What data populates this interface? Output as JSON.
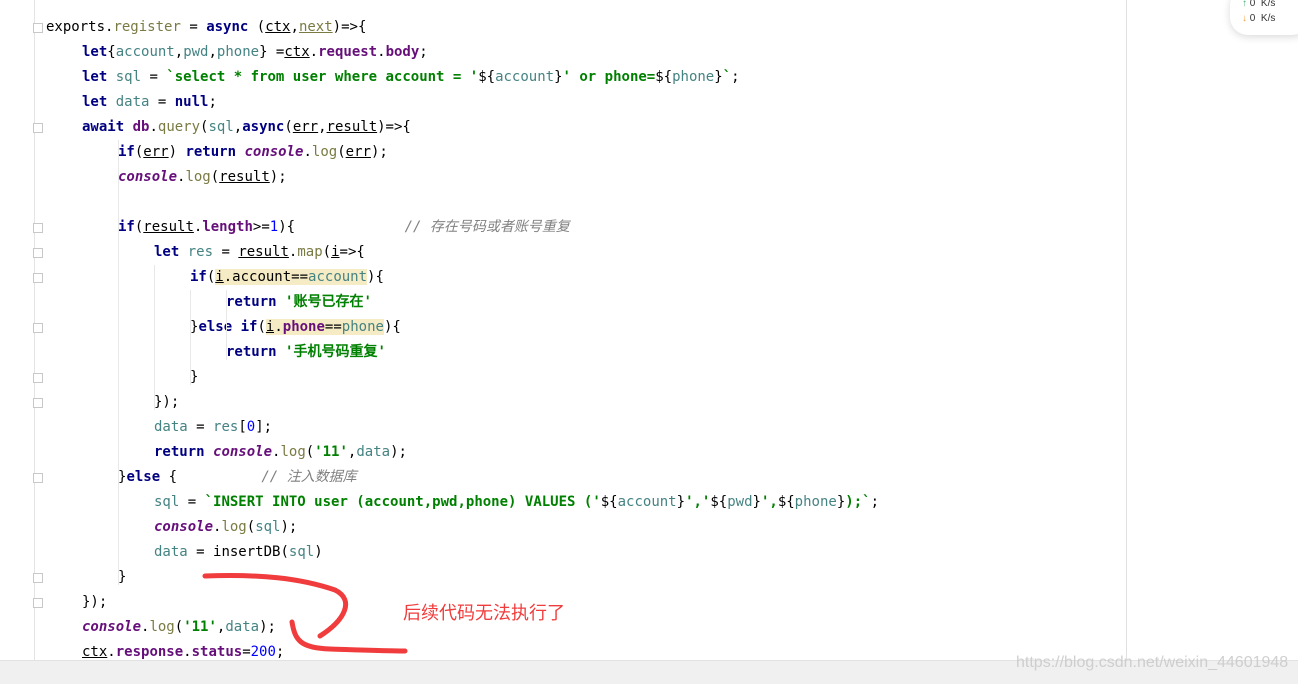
{
  "editor": {
    "lines": [
      {
        "indent": 0,
        "fold": true,
        "tokens": [
          [
            "exports",
            "plain"
          ],
          [
            ".",
            "plain"
          ],
          [
            "register",
            "fn"
          ],
          [
            " = ",
            "plain"
          ],
          [
            "async",
            "kw"
          ],
          [
            " (",
            "plain"
          ],
          [
            "ctx",
            "u"
          ],
          [
            ",",
            "plain"
          ],
          [
            "next",
            "u fn"
          ],
          [
            ")=>{",
            "plain"
          ]
        ]
      },
      {
        "indent": 1,
        "tokens": [
          [
            "let",
            "kw"
          ],
          [
            "{",
            "plain"
          ],
          [
            "account",
            "var"
          ],
          [
            ",",
            "plain"
          ],
          [
            "pwd",
            "var"
          ],
          [
            ",",
            "plain"
          ],
          [
            "phone",
            "var"
          ],
          [
            "} =",
            "plain"
          ],
          [
            "ctx",
            "u"
          ],
          [
            ".",
            "plain"
          ],
          [
            "request",
            "prop"
          ],
          [
            ".",
            "plain"
          ],
          [
            "body",
            "prop"
          ],
          [
            ";",
            "plain"
          ]
        ]
      },
      {
        "indent": 1,
        "tokens": [
          [
            "let",
            "kw"
          ],
          [
            " ",
            "plain"
          ],
          [
            "sql",
            "var"
          ],
          [
            " = ",
            "plain"
          ],
          [
            "`select * from user where account = '",
            "str"
          ],
          [
            "${",
            "plain"
          ],
          [
            "account",
            "var"
          ],
          [
            "}",
            "plain"
          ],
          [
            "' or phone=",
            "str"
          ],
          [
            "${",
            "plain"
          ],
          [
            "phone",
            "var"
          ],
          [
            "}",
            "plain"
          ],
          [
            "`",
            "str"
          ],
          [
            ";",
            "plain"
          ]
        ]
      },
      {
        "indent": 1,
        "tokens": [
          [
            "let",
            "kw"
          ],
          [
            " ",
            "plain"
          ],
          [
            "data",
            "var"
          ],
          [
            " = ",
            "plain"
          ],
          [
            "null",
            "kw"
          ],
          [
            ";",
            "plain"
          ]
        ]
      },
      {
        "indent": 1,
        "fold": true,
        "tokens": [
          [
            "await",
            "kw"
          ],
          [
            " ",
            "plain"
          ],
          [
            "db",
            "prop"
          ],
          [
            ".",
            "plain"
          ],
          [
            "query",
            "fn"
          ],
          [
            "(",
            "plain"
          ],
          [
            "sql",
            "var"
          ],
          [
            ",",
            "plain"
          ],
          [
            "async",
            "kw"
          ],
          [
            "(",
            "plain"
          ],
          [
            "err",
            "u"
          ],
          [
            ",",
            "plain"
          ],
          [
            "result",
            "u"
          ],
          [
            ")=>{",
            "plain"
          ]
        ]
      },
      {
        "indent": 2,
        "tokens": [
          [
            "if",
            "kw"
          ],
          [
            "(",
            "plain"
          ],
          [
            "err",
            "u"
          ],
          [
            ") ",
            "plain"
          ],
          [
            "return",
            "kw"
          ],
          [
            " ",
            "plain"
          ],
          [
            "console",
            "it"
          ],
          [
            ".",
            "plain"
          ],
          [
            "log",
            "fn"
          ],
          [
            "(",
            "plain"
          ],
          [
            "err",
            "u"
          ],
          [
            ");",
            "plain"
          ]
        ]
      },
      {
        "indent": 2,
        "tokens": [
          [
            "console",
            "it"
          ],
          [
            ".",
            "plain"
          ],
          [
            "log",
            "fn"
          ],
          [
            "(",
            "plain"
          ],
          [
            "result",
            "u"
          ],
          [
            ");",
            "plain"
          ]
        ]
      },
      {
        "indent": 2,
        "tokens": []
      },
      {
        "indent": 2,
        "fold": true,
        "tokens": [
          [
            "if",
            "kw"
          ],
          [
            "(",
            "plain"
          ],
          [
            "result",
            "u"
          ],
          [
            ".",
            "plain"
          ],
          [
            "length",
            "prop"
          ],
          [
            ">=",
            "plain"
          ],
          [
            "1",
            "num"
          ],
          [
            "){",
            "plain"
          ],
          [
            "             ",
            "plain"
          ],
          [
            "// 存在号码或者账号重复",
            "cm"
          ]
        ]
      },
      {
        "indent": 3,
        "fold": true,
        "tokens": [
          [
            "let",
            "kw"
          ],
          [
            " ",
            "plain"
          ],
          [
            "res",
            "var"
          ],
          [
            " = ",
            "plain"
          ],
          [
            "result",
            "u"
          ],
          [
            ".",
            "plain"
          ],
          [
            "map",
            "fn"
          ],
          [
            "(",
            "plain"
          ],
          [
            "i",
            "u"
          ],
          [
            "=>{",
            "plain"
          ]
        ]
      },
      {
        "indent": 4,
        "fold": true,
        "tokens": [
          [
            "if",
            "kw"
          ],
          [
            "(",
            "plain"
          ],
          [
            "i",
            "u hl"
          ],
          [
            ".account==",
            "hl"
          ],
          [
            "account",
            "var hl"
          ],
          [
            "){",
            "plain"
          ]
        ]
      },
      {
        "indent": 5,
        "tokens": [
          [
            "return",
            "kw"
          ],
          [
            " ",
            "plain"
          ],
          [
            "'账号已存在'",
            "str"
          ]
        ]
      },
      {
        "indent": 4,
        "fold": true,
        "tokens": [
          [
            "}",
            "plain"
          ],
          [
            "else",
            "kw"
          ],
          [
            " ",
            "plain"
          ],
          [
            "if",
            "kw"
          ],
          [
            "(",
            "plain"
          ],
          [
            "i",
            "u hl"
          ],
          [
            ".",
            "hl"
          ],
          [
            "phone",
            "prop hl"
          ],
          [
            "==",
            "hl"
          ],
          [
            "phone",
            "var hl"
          ],
          [
            "){",
            "plain"
          ]
        ]
      },
      {
        "indent": 5,
        "tokens": [
          [
            "return",
            "kw"
          ],
          [
            " ",
            "plain"
          ],
          [
            "'手机号码重复'",
            "str"
          ]
        ]
      },
      {
        "indent": 4,
        "fold": true,
        "tokens": [
          [
            "}",
            "plain"
          ]
        ]
      },
      {
        "indent": 3,
        "fold": true,
        "tokens": [
          [
            "});",
            "plain"
          ]
        ]
      },
      {
        "indent": 3,
        "tokens": [
          [
            "data",
            "var"
          ],
          [
            " = ",
            "plain"
          ],
          [
            "res",
            "var"
          ],
          [
            "[",
            "plain"
          ],
          [
            "0",
            "num"
          ],
          [
            "];",
            "plain"
          ]
        ]
      },
      {
        "indent": 3,
        "tokens": [
          [
            "return",
            "kw"
          ],
          [
            " ",
            "plain"
          ],
          [
            "console",
            "it"
          ],
          [
            ".",
            "plain"
          ],
          [
            "log",
            "fn"
          ],
          [
            "(",
            "plain"
          ],
          [
            "'11'",
            "str"
          ],
          [
            ",",
            "plain"
          ],
          [
            "data",
            "var"
          ],
          [
            ");",
            "plain"
          ]
        ]
      },
      {
        "indent": 2,
        "fold": true,
        "tokens": [
          [
            "}",
            "plain"
          ],
          [
            "else",
            "kw"
          ],
          [
            " {",
            "plain"
          ],
          [
            "          ",
            "plain"
          ],
          [
            "// 注入数据库",
            "cm"
          ]
        ]
      },
      {
        "indent": 3,
        "tokens": [
          [
            "sql",
            "var"
          ],
          [
            " = ",
            "plain"
          ],
          [
            "`INSERT INTO user (account,pwd,phone) VALUES ('",
            "str"
          ],
          [
            "${",
            "plain"
          ],
          [
            "account",
            "var"
          ],
          [
            "}",
            "plain"
          ],
          [
            "','",
            "str"
          ],
          [
            "${",
            "plain"
          ],
          [
            "pwd",
            "var"
          ],
          [
            "}",
            "plain"
          ],
          [
            "',",
            "str"
          ],
          [
            "${",
            "plain"
          ],
          [
            "phone",
            "var"
          ],
          [
            "}",
            "plain"
          ],
          [
            ");`",
            "str"
          ],
          [
            ";",
            "plain"
          ]
        ]
      },
      {
        "indent": 3,
        "tokens": [
          [
            "console",
            "it"
          ],
          [
            ".",
            "plain"
          ],
          [
            "log",
            "fn"
          ],
          [
            "(",
            "plain"
          ],
          [
            "sql",
            "var"
          ],
          [
            ");",
            "plain"
          ]
        ]
      },
      {
        "indent": 3,
        "tokens": [
          [
            "data",
            "var"
          ],
          [
            " = ",
            "plain"
          ],
          [
            "insertDB",
            "plain"
          ],
          [
            "(",
            "plain"
          ],
          [
            "sql",
            "var"
          ],
          [
            ")",
            "plain"
          ]
        ]
      },
      {
        "indent": 2,
        "fold": true,
        "tokens": [
          [
            "}",
            "plain"
          ]
        ]
      },
      {
        "indent": 1,
        "fold": true,
        "tokens": [
          [
            "});",
            "plain"
          ]
        ]
      },
      {
        "indent": 1,
        "tokens": [
          [
            "console",
            "it"
          ],
          [
            ".",
            "plain"
          ],
          [
            "log",
            "fn"
          ],
          [
            "(",
            "plain"
          ],
          [
            "'11'",
            "str"
          ],
          [
            ",",
            "plain"
          ],
          [
            "data",
            "var"
          ],
          [
            ");",
            "plain"
          ]
        ]
      },
      {
        "indent": 1,
        "tokens": [
          [
            "ctx",
            "u"
          ],
          [
            ".",
            "plain"
          ],
          [
            "response",
            "prop"
          ],
          [
            ".",
            "plain"
          ],
          [
            "status",
            "prop"
          ],
          [
            "=",
            "plain"
          ],
          [
            "200",
            "num"
          ],
          [
            ";",
            "plain"
          ]
        ]
      }
    ]
  },
  "annotation": {
    "text": "后续代码无法执行了",
    "color": "#f03c3c"
  },
  "speed_widget": {
    "upload": "0",
    "download": "0",
    "unit": "K/s",
    "upload_color": "#3cb371",
    "download_color": "#f0a040"
  },
  "watermark": "https://blog.csdn.net/weixin_44601948"
}
